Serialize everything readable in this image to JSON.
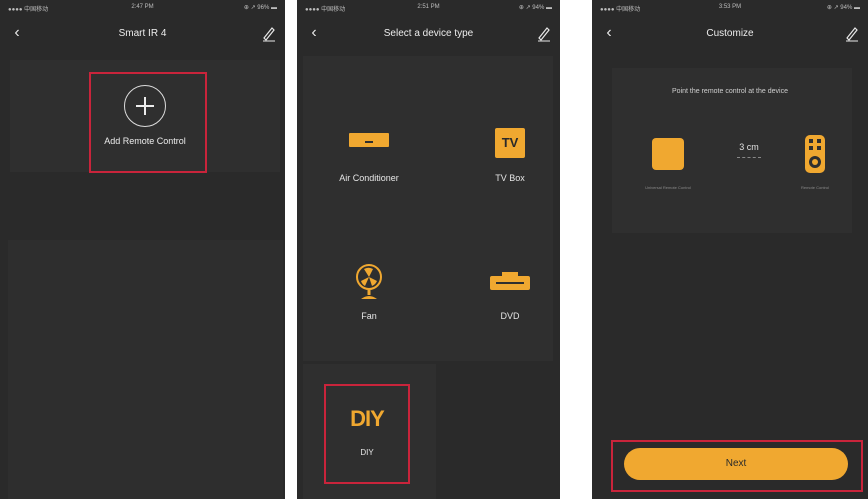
{
  "phone1": {
    "status": {
      "left": "●●●● 中国移动 ",
      "center": "2:47 PM",
      "right": "⊕ ↗ 96% ▬"
    },
    "title": "Smart IR 4",
    "add_label": "Add Remote Control"
  },
  "phone2": {
    "status": {
      "left": "●●●● 中国移动 ",
      "center": "2:51 PM",
      "right": "⊕ ↗ 94% ▬"
    },
    "title": "Select a device type",
    "devices": [
      {
        "label": "Air Conditioner"
      },
      {
        "label": "TV Box",
        "icon_text": "TV"
      },
      {
        "label": "Fan"
      },
      {
        "label": "DVD"
      }
    ],
    "diy_title": "DIY",
    "diy_label": "DIY"
  },
  "phone3": {
    "status": {
      "left": "●●●● 中国移动 ",
      "center": "3:53 PM",
      "right": "⊕ ↗ 94% ▬"
    },
    "title": "Customize",
    "instruction": "Point the remote control at the device",
    "distance": "3 cm",
    "left_caption": "Universal Remote Control",
    "right_caption": "Remote Control",
    "next_label": "Next"
  },
  "colors": {
    "accent": "#f0a830",
    "highlight": "#c9243b",
    "background": "#2a2a2a"
  }
}
